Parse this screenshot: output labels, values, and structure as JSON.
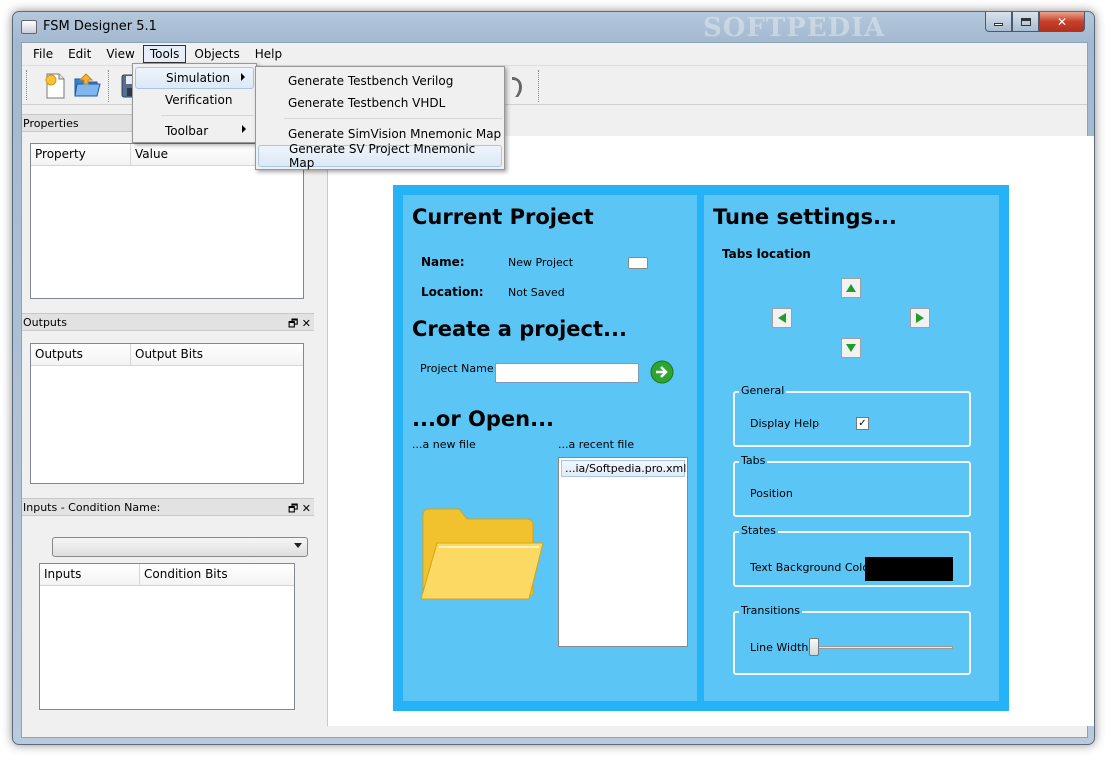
{
  "window": {
    "title": "FSM Designer 5.1",
    "watermark": "SOFTPEDIA"
  },
  "menubar": {
    "items": [
      "File",
      "Edit",
      "View",
      "Tools",
      "Objects",
      "Help"
    ],
    "active": "Tools"
  },
  "tools_menu": {
    "items": [
      {
        "label": "Simulation",
        "has_submenu": true,
        "highlighted": true
      },
      {
        "label": "Verification",
        "has_submenu": false
      },
      {
        "label": "Toolbar",
        "has_submenu": true
      }
    ]
  },
  "simulation_submenu": {
    "items": [
      "Generate Testbench Verilog",
      "Generate Testbench VHDL",
      "Generate SimVision Mnemonic Map",
      "Generate SV Project Mnemonic Map"
    ],
    "highlighted": "Generate SV Project Mnemonic Map"
  },
  "properties_panel": {
    "title": "Properties",
    "columns": [
      "Property",
      "Value"
    ]
  },
  "outputs_panel": {
    "title": "Outputs",
    "columns": [
      "Outputs",
      "Output Bits"
    ]
  },
  "inputs_panel": {
    "title": "Inputs - Condition Name:",
    "combo_value": "",
    "columns": [
      "Inputs",
      "Condition Bits"
    ]
  },
  "current_project": {
    "heading": "Current Project",
    "name_label": "Name:",
    "name_value": "New Project",
    "location_label": "Location:",
    "location_value": "Not Saved"
  },
  "create_project": {
    "heading": "Create a project...",
    "project_name_label": "Project Name:",
    "project_name_value": ""
  },
  "open_section": {
    "heading": "...or Open...",
    "new_file_label": "...a new file",
    "recent_file_label": "...a recent file",
    "recent_files": [
      "...ia/Softpedia.pro.xml"
    ]
  },
  "tune_settings": {
    "heading": "Tune settings...",
    "tabs_location_label": "Tabs location",
    "general": {
      "title": "General",
      "display_help_label": "Display Help",
      "display_help_checked": true
    },
    "tabs": {
      "title": "Tabs",
      "position_label": "Position"
    },
    "states": {
      "title": "States",
      "text_bg_color_label": "Text Background Color",
      "text_bg_color": "#000000"
    },
    "transitions": {
      "title": "Transitions",
      "line_width_label": "Line Width",
      "line_width_level": 0.0
    }
  },
  "colors": {
    "page_bg": "#25b2f7",
    "panel_bg": "#5bc5f6",
    "arrow_green": "#1e9e28"
  }
}
